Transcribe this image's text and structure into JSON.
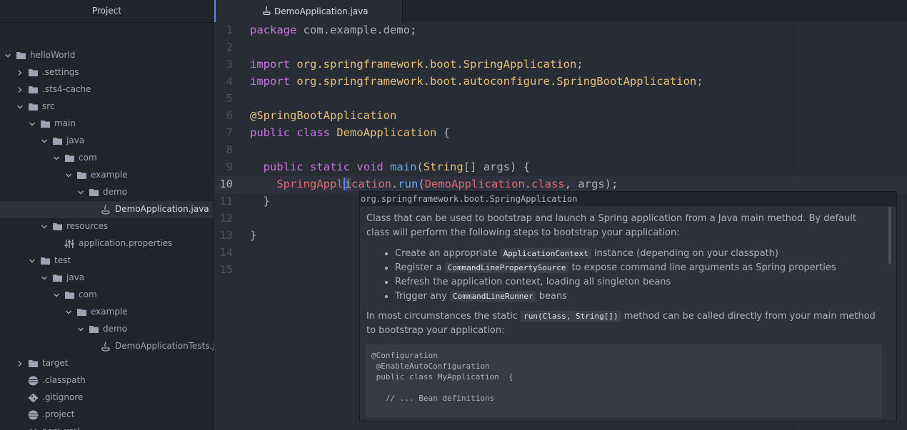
{
  "sidebar": {
    "title": "Project"
  },
  "tree": [
    {
      "label": "helloWorld",
      "type": "folder",
      "expanded": true,
      "depth": 0
    },
    {
      "label": ".settings",
      "type": "folder",
      "expanded": false,
      "depth": 1
    },
    {
      "label": ".sts4-cache",
      "type": "folder",
      "expanded": false,
      "depth": 1
    },
    {
      "label": "src",
      "type": "folder",
      "expanded": true,
      "depth": 1
    },
    {
      "label": "main",
      "type": "folder",
      "expanded": true,
      "depth": 2
    },
    {
      "label": "java",
      "type": "folder",
      "expanded": true,
      "depth": 3
    },
    {
      "label": "com",
      "type": "folder",
      "expanded": true,
      "depth": 4
    },
    {
      "label": "example",
      "type": "folder",
      "expanded": true,
      "depth": 5
    },
    {
      "label": "demo",
      "type": "folder",
      "expanded": true,
      "depth": 6
    },
    {
      "label": "DemoApplication.java",
      "type": "java",
      "depth": 7,
      "selected": true
    },
    {
      "label": "resources",
      "type": "folder",
      "expanded": true,
      "depth": 3
    },
    {
      "label": "application.properties",
      "type": "props",
      "depth": 4
    },
    {
      "label": "test",
      "type": "folder",
      "expanded": true,
      "depth": 2
    },
    {
      "label": "java",
      "type": "folder",
      "expanded": true,
      "depth": 3
    },
    {
      "label": "com",
      "type": "folder",
      "expanded": true,
      "depth": 4
    },
    {
      "label": "example",
      "type": "folder",
      "expanded": true,
      "depth": 5
    },
    {
      "label": "demo",
      "type": "folder",
      "expanded": true,
      "depth": 6
    },
    {
      "label": "DemoApplicationTests.java",
      "type": "java",
      "depth": 7
    },
    {
      "label": "target",
      "type": "folder",
      "expanded": false,
      "depth": 1
    },
    {
      "label": ".classpath",
      "type": "db",
      "depth": 1
    },
    {
      "label": ".gitignore",
      "type": "git",
      "depth": 1
    },
    {
      "label": ".project",
      "type": "db",
      "depth": 1
    },
    {
      "label": "pom.xml",
      "type": "code",
      "depth": 1
    }
  ],
  "tab": {
    "label": "DemoApplication.java"
  },
  "editor": {
    "current_line": 10,
    "lines": [
      [
        [
          "kw",
          "package"
        ],
        [
          "pl",
          " com.example.demo;"
        ]
      ],
      [],
      [
        [
          "kw",
          "import"
        ],
        [
          "pl",
          " "
        ],
        [
          "ty",
          "org.springframework.boot.SpringApplication"
        ],
        [
          "pl",
          ";"
        ]
      ],
      [
        [
          "kw",
          "import"
        ],
        [
          "pl",
          " "
        ],
        [
          "ty",
          "org.springframework.boot.autoconfigure.SpringBootApplication"
        ],
        [
          "pl",
          ";"
        ]
      ],
      [],
      [
        [
          "ann",
          "@SpringBootApplication"
        ]
      ],
      [
        [
          "kw",
          "public"
        ],
        [
          "pl",
          " "
        ],
        [
          "kw",
          "class"
        ],
        [
          "pl",
          " "
        ],
        [
          "ty",
          "DemoApplication"
        ],
        [
          "pl",
          " {"
        ]
      ],
      [],
      [
        [
          "pl",
          "  "
        ],
        [
          "kw",
          "public"
        ],
        [
          "pl",
          " "
        ],
        [
          "kw",
          "static"
        ],
        [
          "pl",
          " "
        ],
        [
          "kw",
          "void"
        ],
        [
          "pl",
          " "
        ],
        [
          "fn",
          "main"
        ],
        [
          "pl",
          "("
        ],
        [
          "ty",
          "String"
        ],
        [
          "pl",
          "[] args) {"
        ]
      ],
      [
        [
          "pl",
          "    "
        ],
        [
          "red",
          "SpringAppl"
        ],
        [
          "caret",
          "i"
        ],
        [
          "red",
          "cation"
        ],
        [
          "pl",
          "."
        ],
        [
          "fn",
          "run"
        ],
        [
          "pl",
          "("
        ],
        [
          "red",
          "DemoApplication"
        ],
        [
          "pl",
          "."
        ],
        [
          "red",
          "class"
        ],
        [
          "pl",
          ", args);"
        ]
      ],
      [
        [
          "pl",
          "  }"
        ]
      ],
      [],
      [
        [
          "pl",
          "}"
        ]
      ],
      [],
      []
    ]
  },
  "tooltip": {
    "title": "org.springframework.boot.SpringApplication",
    "intro": "Class that can be used to bootstrap and launch a Spring application from a Java main method. By default class will perform the following steps to bootstrap your application:",
    "bullets": [
      [
        [
          "t",
          "Create an appropriate "
        ],
        [
          "c",
          "ApplicationContext"
        ],
        [
          "t",
          " instance (depending on your classpath)"
        ]
      ],
      [
        [
          "t",
          "Register a "
        ],
        [
          "c",
          "CommandLinePropertySource"
        ],
        [
          "t",
          " to expose command line arguments as Spring properties"
        ]
      ],
      [
        [
          "t",
          "Refresh the application context, loading all singleton beans"
        ]
      ],
      [
        [
          "t",
          "Trigger any "
        ],
        [
          "c",
          "CommandLineRunner"
        ],
        [
          "t",
          " beans"
        ]
      ]
    ],
    "para2": [
      [
        "t",
        "In most circumstances the static "
      ],
      [
        "c",
        "run(Class, String[])"
      ],
      [
        "t",
        " method can be called directly from your main method to bootstrap your application:"
      ]
    ],
    "code": "@Configuration\n @EnableAutoConfiguration\n public class MyApplication  {\n\n   // ... Bean definitions"
  }
}
